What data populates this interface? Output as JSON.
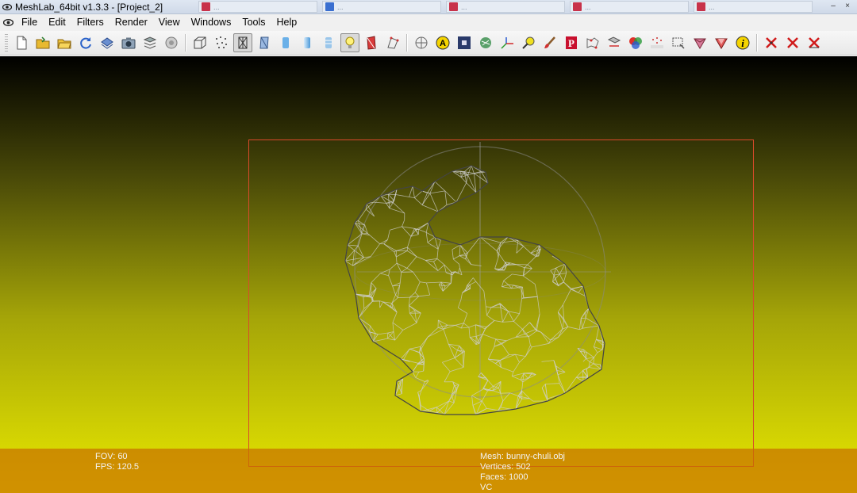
{
  "window": {
    "title": "MeshLab_64bit v1.3.3 - [Project_2]",
    "background_tabs": [
      "...",
      "...",
      "...",
      "...",
      "...",
      "..."
    ]
  },
  "menu": [
    "File",
    "Edit",
    "Filters",
    "Render",
    "View",
    "Windows",
    "Tools",
    "Help"
  ],
  "toolbar": {
    "icons": [
      "new-file-icon",
      "open-icon",
      "open-project-icon",
      "reload-icon",
      "save-icon",
      "snapshot-icon",
      "layers-icon",
      "settings-icon",
      "bounding-box-icon",
      "points-icon",
      "wireframe-icon",
      "hidden-lines-icon",
      "flat-shading-icon",
      "smooth-shading-icon",
      "texture-icon",
      "light-icon",
      "backface-icon",
      "select-faces-icon",
      "trackball-icon",
      "annotate-icon",
      "measure-icon",
      "paint-icon",
      "axis-icon",
      "pick-points-icon",
      "brush-icon",
      "pdf-icon",
      "align-icon",
      "sample-icon",
      "color-icon",
      "reference-icon",
      "edit-selection-icon",
      "select-vertex-icon",
      "delete-faces-icon",
      "info-icon",
      "delete-vertices-icon",
      "delete-faces-x-icon",
      "delete-all-icon"
    ],
    "active": [
      "wireframe-icon",
      "light-icon"
    ]
  },
  "viewport": {
    "background_top": "#000000",
    "background_bottom": "#e8e800",
    "selection_color": "#d94a2a",
    "info_bar_color": "#c87000"
  },
  "info": {
    "fov": "FOV: 60",
    "fps": "FPS:   120.5",
    "mesh": "Mesh: bunny-chuli.obj",
    "vertices": "Vertices: 502",
    "faces": "Faces: 1000",
    "vc": "VC"
  }
}
